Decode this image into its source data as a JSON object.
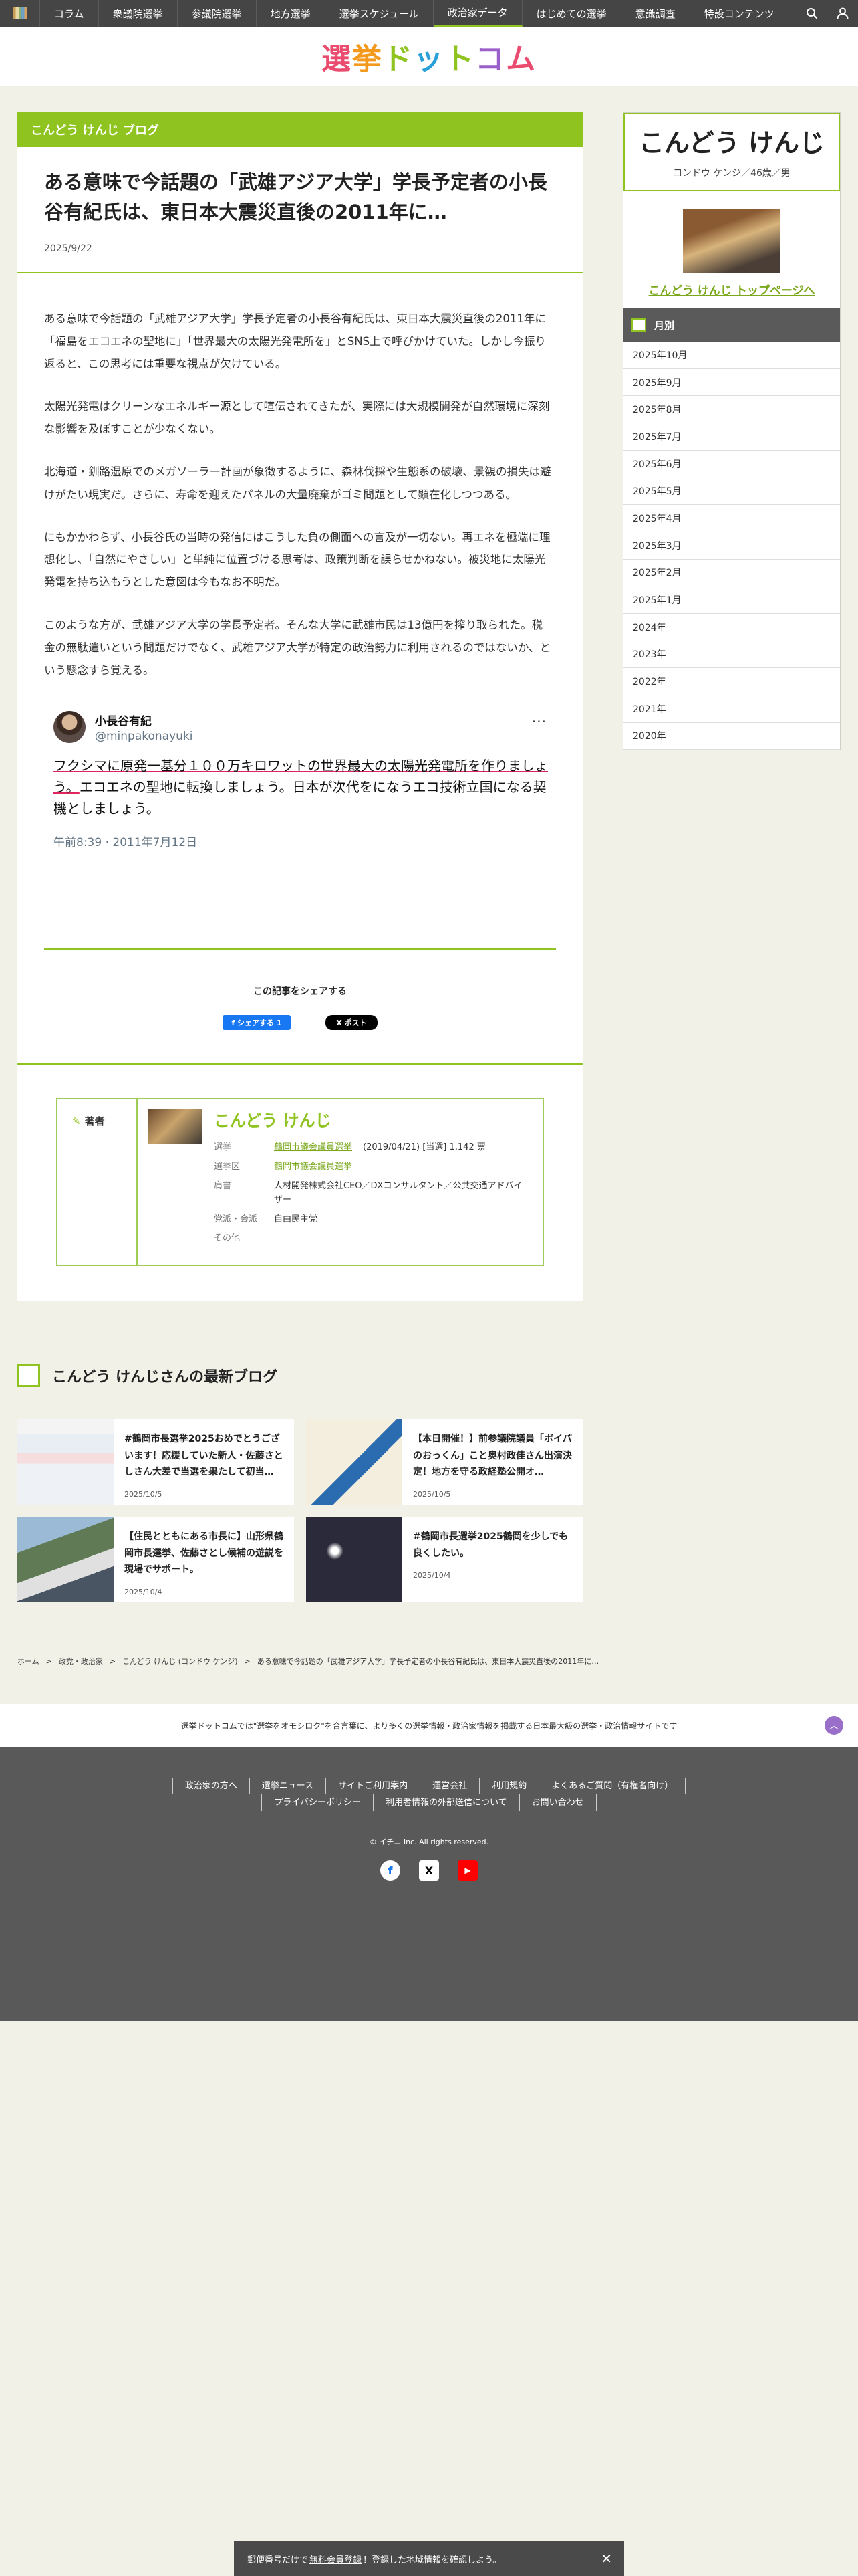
{
  "nav": {
    "items": [
      "コラム",
      "衆議院選挙",
      "参議院選挙",
      "地方選挙",
      "選挙スケジュール",
      "政治家データ",
      "はじめての選挙",
      "意識調査",
      "特設コンテンツ"
    ],
    "active": "政治家データ"
  },
  "logo": {
    "text": "選挙ドットコム"
  },
  "article": {
    "category": "こんどう けんじ ブログ",
    "title": "ある意味で今話題の「武雄アジア大学」学長予定者の小長谷有紀氏は、東日本大震災直後の2011年に…",
    "date": "2025/9/22",
    "paragraphs": [
      "ある意味で今話題の「武雄アジア大学」学長予定者の小長谷有紀氏は、東日本大震災直後の2011年に「福島をエコエネの聖地に」「世界最大の太陽光発電所を」とSNS上で呼びかけていた。しかし今振り返ると、この思考には重要な視点が欠けている。",
      "太陽光発電はクリーンなエネルギー源として喧伝されてきたが、実際には大規模開発が自然環境に深刻な影響を及ぼすことが少なくない。",
      "北海道・釧路湿原でのメガソーラー計画が象徴するように、森林伐採や生態系の破壊、景観の損失は避けがたい現実だ。さらに、寿命を迎えたパネルの大量廃棄がゴミ問題として顕在化しつつある。",
      "にもかかわらず、小長谷氏の当時の発信にはこうした負の側面への言及が一切ない。再エネを極端に理想化し、「自然にやさしい」と単純に位置づける思考は、政策判断を誤らせかねない。被災地に太陽光発電を持ち込もうとした意図は今もなお不明だ。",
      "このような方が、武雄アジア大学の学長予定者。そんな大学に武雄市民は13億円を搾り取られた。税金の無駄遣いという問題だけでなく、武雄アジア大学が特定の政治勢力に利用されるのではないか、という懸念すら覚える。"
    ]
  },
  "tweet": {
    "name": "小長谷有紀",
    "handle": "@minpakonayuki",
    "text_highlight": "フクシマに原発一基分１００万キロワットの世界最大の太陽光発電所を作りましょう。",
    "text_rest": "エコエネの聖地に転換しましょう。日本が次代をになうエコ技術立国になる契機としましょう。",
    "time": "午前8:39 · 2011年7月12日",
    "more": "···"
  },
  "share": {
    "title": "この記事をシェアする",
    "fb": "f シェアする 1",
    "x": "X ポスト"
  },
  "author": {
    "label": "著者",
    "name": "こんどう けんじ",
    "rows": [
      {
        "k": "選挙",
        "v": "鶴岡市議会議員選挙",
        "extra": "(2019/04/21) [当選] 1,142 票"
      },
      {
        "k": "選挙区",
        "v": "鶴岡市議会議員選挙",
        "extra": ""
      },
      {
        "k": "肩書",
        "v": "人材開発株式会社CEO／DXコンサルタント／公共交通アドバイザー",
        "extra": ""
      },
      {
        "k": "党派・会派",
        "v": "自由民主党",
        "extra": ""
      },
      {
        "k": "その他",
        "v": "",
        "extra": ""
      }
    ]
  },
  "sidebar": {
    "name": "こんどう けんじ",
    "meta": "コンドウ ケンジ／46歳／男",
    "link": "こんどう けんじ トップページへ",
    "month_title": "月別",
    "months": [
      "2025年10月",
      "2025年9月",
      "2025年8月",
      "2025年7月",
      "2025年6月",
      "2025年5月",
      "2025年4月",
      "2025年3月",
      "2025年2月",
      "2025年1月",
      "2024年",
      "2023年",
      "2022年",
      "2021年",
      "2020年"
    ]
  },
  "latest": {
    "title": "こんどう けんじさんの最新ブログ",
    "cards": [
      {
        "title": "#鶴岡市長選挙2025おめでとうございます！応援していた新人・佐藤さとしさん大差で当選を果たして初当…",
        "date": "2025/10/5"
      },
      {
        "title": "【本日開催！】前参議院議員「ボイパのおっくん」こと奥村政佳さん出演決定！地方を守る政経塾公開オ…",
        "date": "2025/10/5"
      },
      {
        "title": "【住民とともにある市長に】山形県鶴岡市長選挙、佐藤さとし候補の遊説を現場でサポート。",
        "date": "2025/10/4"
      },
      {
        "title": "#鶴岡市長選挙2025鶴岡を少しでも良くしたい。",
        "date": "2025/10/4"
      }
    ]
  },
  "breadcrumb": [
    "ホーム",
    "政党・政治家",
    "こんどう けんじ (コンドウ ケンジ)",
    "ある意味で今話題の「武雄アジア大学」学長予定者の小長谷有紀氏は、東日本大震災直後の2011年に…"
  ],
  "tagline": "選挙ドットコムでは\"選挙をオモシロク\"を合言葉に、より多くの選挙情報・政治家情報を掲載する日本最大級の選挙・政治情報サイトです",
  "footer": {
    "row1": [
      "政治家の方へ",
      "選挙ニュース",
      "サイトご利用案内",
      "運営会社",
      "利用規約",
      "よくあるご質問（有権者向け）"
    ],
    "row2": [
      "プライバシーポリシー",
      "利用者情報の外部送信について",
      "お問い合わせ"
    ],
    "copyright": "© イチニ Inc. All rights reserved."
  },
  "bottombar": {
    "pre": "郵便番号だけで",
    "link": "無料会員登録",
    "post": "！登録した地域情報を確認しよう。",
    "close": "✕"
  }
}
